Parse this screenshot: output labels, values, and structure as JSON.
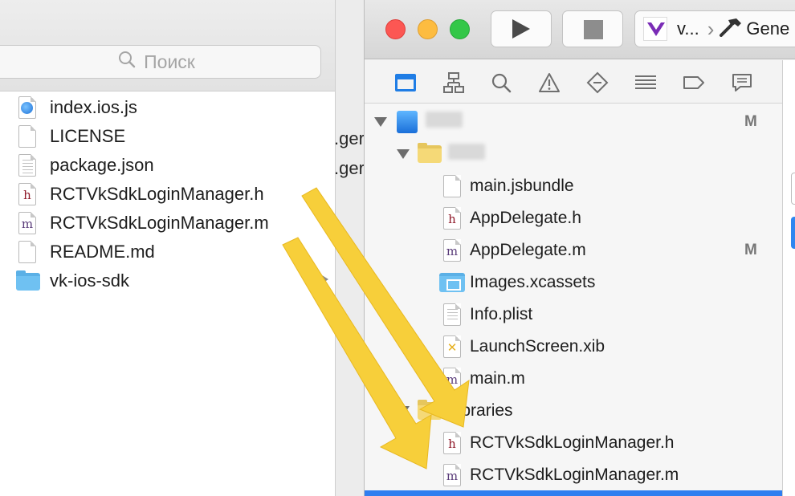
{
  "finder": {
    "search_placeholder": "Поиск",
    "files": [
      {
        "name": "index.ios.js",
        "icon": "javascript-file-icon"
      },
      {
        "name": "LICENSE",
        "icon": "document-icon"
      },
      {
        "name": "package.json",
        "icon": "text-document-icon"
      },
      {
        "name": "RCTVkSdkLoginManager.h",
        "icon": "header-file-icon"
      },
      {
        "name": "RCTVkSdkLoginManager.m",
        "icon": "objc-source-file-icon"
      },
      {
        "name": "README.md",
        "icon": "document-icon"
      },
      {
        "name": "vk-ios-sdk",
        "icon": "folder-icon"
      }
    ],
    "clipped_text": ".ger"
  },
  "xcode": {
    "scheme": "v...",
    "destination": "Gene",
    "project_badge": "M",
    "tree": [
      {
        "label": "",
        "badge": "M",
        "level": 0
      },
      {
        "label": "",
        "level": 1
      },
      {
        "label": "main.jsbundle",
        "level": 2
      },
      {
        "label": "AppDelegate.h",
        "level": 2
      },
      {
        "label": "AppDelegate.m",
        "badge": "M",
        "level": 2
      },
      {
        "label": "Images.xcassets",
        "level": 2
      },
      {
        "label": "Info.plist",
        "level": 2
      },
      {
        "label": "LaunchScreen.xib",
        "level": 2
      },
      {
        "label": "main.m",
        "level": 2
      },
      {
        "label": "Libraries",
        "level": 1
      },
      {
        "label": "RCTVkSdkLoginManager.h",
        "level": 2
      },
      {
        "label": "RCTVkSdkLoginManager.m",
        "level": 2
      }
    ]
  },
  "colors": {
    "accent": "#1f7de5",
    "arrow": "#f7cf3a",
    "header_glyph": "#8f1a2a",
    "impl_glyph": "#5a3c7a"
  },
  "icons": {
    "search": "magnifier-icon",
    "run": "play-icon",
    "stop": "stop-icon",
    "scheme": "vue-logo-icon",
    "destination": "hammer-icon"
  }
}
